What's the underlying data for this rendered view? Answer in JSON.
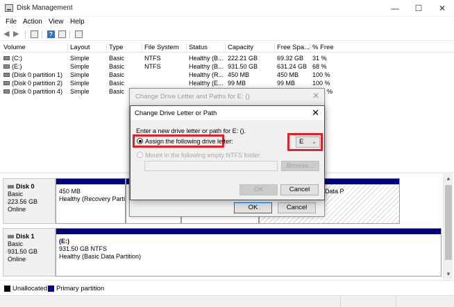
{
  "window": {
    "title": "Disk Management",
    "minimize": "—",
    "maximize": "☐",
    "close": "✕"
  },
  "menu": [
    "File",
    "Action",
    "View",
    "Help"
  ],
  "table": {
    "columns": [
      "Volume",
      "Layout",
      "Type",
      "File System",
      "Status",
      "Capacity",
      "Free Spa...",
      "% Free"
    ],
    "rows": [
      [
        "(C:)",
        "Simple",
        "Basic",
        "NTFS",
        "Healthy (B...",
        "222.21 GB",
        "69.32 GB",
        "31 %"
      ],
      [
        "(E:)",
        "Simple",
        "Basic",
        "NTFS",
        "Healthy (B...",
        "931.50 GB",
        "631.24 GB",
        "68 %"
      ],
      [
        "(Disk 0 partition 1)",
        "Simple",
        "Basic",
        "",
        "Healthy (R...",
        "450 MB",
        "450 MB",
        "100 %"
      ],
      [
        "(Disk 0 partition 2)",
        "Simple",
        "Basic",
        "",
        "Healthy (E...",
        "99 MB",
        "99 MB",
        "100 %"
      ],
      [
        "(Disk 0 partition 4)",
        "Simple",
        "Basic",
        "",
        "",
        "",
        "",
        "%"
      ]
    ]
  },
  "disks": [
    {
      "name": "Disk 0",
      "type": "Basic",
      "size": "223.56 GB",
      "status": "Online",
      "partitions": [
        {
          "line1": "450 MB",
          "line2": "Healthy (Recovery Parti"
        },
        {
          "line1": "",
          "line2": ""
        },
        {
          "line1": "",
          "line2": ""
        },
        {
          "line1": "",
          "line2": "e, Crash Dump, Basic Data P"
        }
      ]
    },
    {
      "name": "Disk 1",
      "type": "Basic",
      "size": "931.50 GB",
      "status": "Online",
      "partitions": [
        {
          "line0": "(E:)",
          "line1": "931.50 GB NTFS",
          "line2": "Healthy (Basic Data Partition)"
        }
      ]
    }
  ],
  "legend": {
    "unallocated": "Unallocated",
    "primary": "Primary partition",
    "colors": {
      "unallocated": "#000000",
      "primary": "#00007f"
    }
  },
  "back_dialog": {
    "title": "Change Drive Letter and Paths for E: ()",
    "close": "✕",
    "ok": "OK",
    "cancel": "Cancel"
  },
  "front_dialog": {
    "title": "Change Drive Letter or Path",
    "close": "✕",
    "prompt": "Enter a new drive letter or path for E: ().",
    "assign_label": "Assign the following drive letter:",
    "mount_label": "Mount in the following empty NTFS folder:",
    "drive_letter": "E",
    "browse": "Browse...",
    "ok": "OK",
    "cancel": "Cancel",
    "highlight_color": "#e1212a"
  },
  "scrollbar": {
    "up": "▲",
    "down": "▼"
  }
}
